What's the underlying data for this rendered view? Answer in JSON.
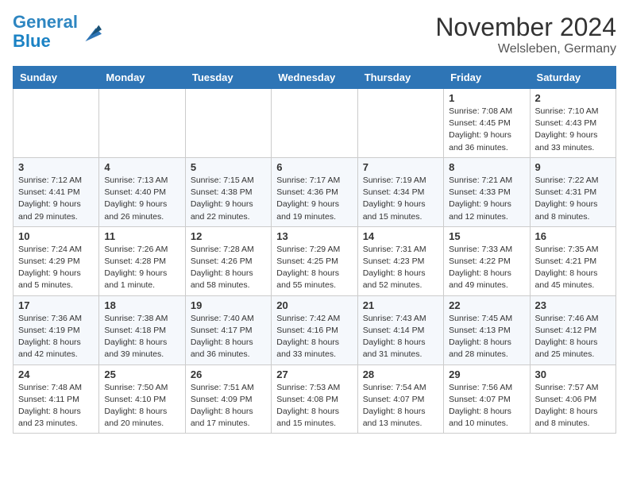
{
  "header": {
    "logo_line1": "General",
    "logo_line2": "Blue",
    "month_title": "November 2024",
    "location": "Welsleben, Germany"
  },
  "days_of_week": [
    "Sunday",
    "Monday",
    "Tuesday",
    "Wednesday",
    "Thursday",
    "Friday",
    "Saturday"
  ],
  "weeks": [
    [
      {
        "day": "",
        "info": ""
      },
      {
        "day": "",
        "info": ""
      },
      {
        "day": "",
        "info": ""
      },
      {
        "day": "",
        "info": ""
      },
      {
        "day": "",
        "info": ""
      },
      {
        "day": "1",
        "info": "Sunrise: 7:08 AM\nSunset: 4:45 PM\nDaylight: 9 hours\nand 36 minutes."
      },
      {
        "day": "2",
        "info": "Sunrise: 7:10 AM\nSunset: 4:43 PM\nDaylight: 9 hours\nand 33 minutes."
      }
    ],
    [
      {
        "day": "3",
        "info": "Sunrise: 7:12 AM\nSunset: 4:41 PM\nDaylight: 9 hours\nand 29 minutes."
      },
      {
        "day": "4",
        "info": "Sunrise: 7:13 AM\nSunset: 4:40 PM\nDaylight: 9 hours\nand 26 minutes."
      },
      {
        "day": "5",
        "info": "Sunrise: 7:15 AM\nSunset: 4:38 PM\nDaylight: 9 hours\nand 22 minutes."
      },
      {
        "day": "6",
        "info": "Sunrise: 7:17 AM\nSunset: 4:36 PM\nDaylight: 9 hours\nand 19 minutes."
      },
      {
        "day": "7",
        "info": "Sunrise: 7:19 AM\nSunset: 4:34 PM\nDaylight: 9 hours\nand 15 minutes."
      },
      {
        "day": "8",
        "info": "Sunrise: 7:21 AM\nSunset: 4:33 PM\nDaylight: 9 hours\nand 12 minutes."
      },
      {
        "day": "9",
        "info": "Sunrise: 7:22 AM\nSunset: 4:31 PM\nDaylight: 9 hours\nand 8 minutes."
      }
    ],
    [
      {
        "day": "10",
        "info": "Sunrise: 7:24 AM\nSunset: 4:29 PM\nDaylight: 9 hours\nand 5 minutes."
      },
      {
        "day": "11",
        "info": "Sunrise: 7:26 AM\nSunset: 4:28 PM\nDaylight: 9 hours\nand 1 minute."
      },
      {
        "day": "12",
        "info": "Sunrise: 7:28 AM\nSunset: 4:26 PM\nDaylight: 8 hours\nand 58 minutes."
      },
      {
        "day": "13",
        "info": "Sunrise: 7:29 AM\nSunset: 4:25 PM\nDaylight: 8 hours\nand 55 minutes."
      },
      {
        "day": "14",
        "info": "Sunrise: 7:31 AM\nSunset: 4:23 PM\nDaylight: 8 hours\nand 52 minutes."
      },
      {
        "day": "15",
        "info": "Sunrise: 7:33 AM\nSunset: 4:22 PM\nDaylight: 8 hours\nand 49 minutes."
      },
      {
        "day": "16",
        "info": "Sunrise: 7:35 AM\nSunset: 4:21 PM\nDaylight: 8 hours\nand 45 minutes."
      }
    ],
    [
      {
        "day": "17",
        "info": "Sunrise: 7:36 AM\nSunset: 4:19 PM\nDaylight: 8 hours\nand 42 minutes."
      },
      {
        "day": "18",
        "info": "Sunrise: 7:38 AM\nSunset: 4:18 PM\nDaylight: 8 hours\nand 39 minutes."
      },
      {
        "day": "19",
        "info": "Sunrise: 7:40 AM\nSunset: 4:17 PM\nDaylight: 8 hours\nand 36 minutes."
      },
      {
        "day": "20",
        "info": "Sunrise: 7:42 AM\nSunset: 4:16 PM\nDaylight: 8 hours\nand 33 minutes."
      },
      {
        "day": "21",
        "info": "Sunrise: 7:43 AM\nSunset: 4:14 PM\nDaylight: 8 hours\nand 31 minutes."
      },
      {
        "day": "22",
        "info": "Sunrise: 7:45 AM\nSunset: 4:13 PM\nDaylight: 8 hours\nand 28 minutes."
      },
      {
        "day": "23",
        "info": "Sunrise: 7:46 AM\nSunset: 4:12 PM\nDaylight: 8 hours\nand 25 minutes."
      }
    ],
    [
      {
        "day": "24",
        "info": "Sunrise: 7:48 AM\nSunset: 4:11 PM\nDaylight: 8 hours\nand 23 minutes."
      },
      {
        "day": "25",
        "info": "Sunrise: 7:50 AM\nSunset: 4:10 PM\nDaylight: 8 hours\nand 20 minutes."
      },
      {
        "day": "26",
        "info": "Sunrise: 7:51 AM\nSunset: 4:09 PM\nDaylight: 8 hours\nand 17 minutes."
      },
      {
        "day": "27",
        "info": "Sunrise: 7:53 AM\nSunset: 4:08 PM\nDaylight: 8 hours\nand 15 minutes."
      },
      {
        "day": "28",
        "info": "Sunrise: 7:54 AM\nSunset: 4:07 PM\nDaylight: 8 hours\nand 13 minutes."
      },
      {
        "day": "29",
        "info": "Sunrise: 7:56 AM\nSunset: 4:07 PM\nDaylight: 8 hours\nand 10 minutes."
      },
      {
        "day": "30",
        "info": "Sunrise: 7:57 AM\nSunset: 4:06 PM\nDaylight: 8 hours\nand 8 minutes."
      }
    ]
  ]
}
